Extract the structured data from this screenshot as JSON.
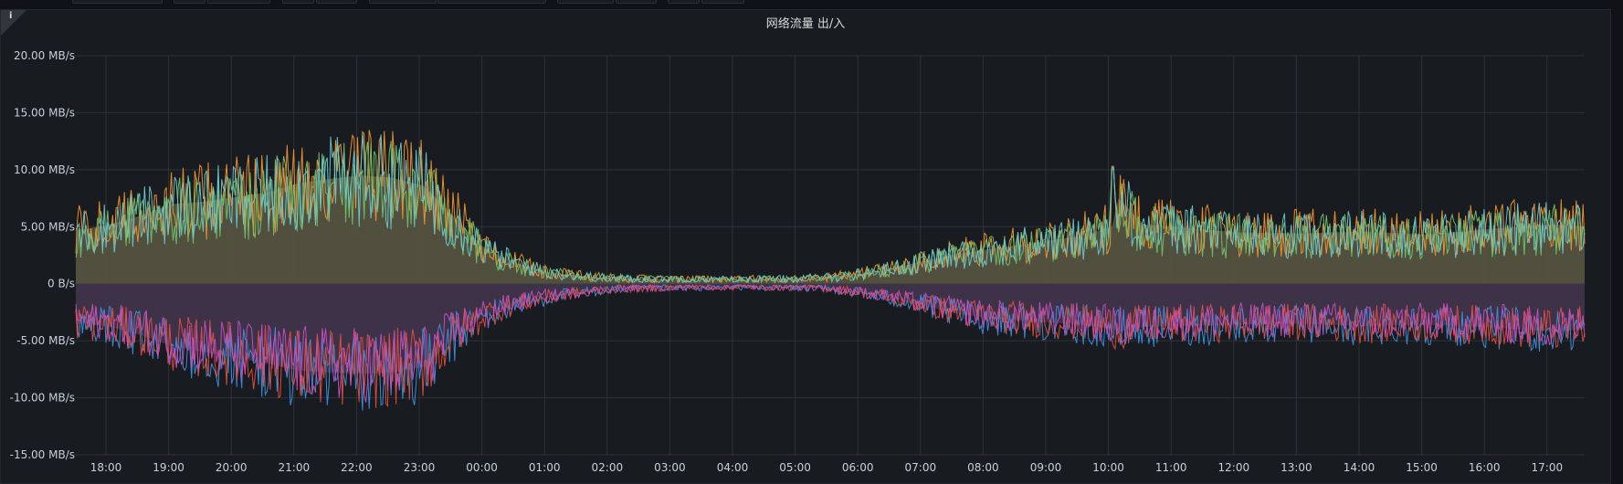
{
  "panel": {
    "title": "网络流量 出/入",
    "info_icon": "info-icon"
  },
  "colors": {
    "background": "#181b1f",
    "grid": "#2f3238",
    "positive_fill": "#54523f",
    "negative_fill": "#3f344b",
    "series_orange": "#f2952b",
    "series_green": "#73bf69",
    "series_teal": "#6ec7cf",
    "series_blue": "#3d8fe0",
    "series_red": "#e24d42",
    "series_purple": "#c351bd"
  },
  "chart_data": {
    "type": "area",
    "title": "网络流量 出/入",
    "xlabel": "",
    "ylabel": "",
    "ylim": [
      -15,
      20
    ],
    "y_unit": "MB/s",
    "y_ticks": [
      {
        "value": 20,
        "label": "20.00 MB/s"
      },
      {
        "value": 15,
        "label": "15.00 MB/s"
      },
      {
        "value": 10,
        "label": "10.00 MB/s"
      },
      {
        "value": 5,
        "label": "5.00 MB/s"
      },
      {
        "value": 0,
        "label": "0 B/s"
      },
      {
        "value": -5,
        "label": "-5.00 MB/s"
      },
      {
        "value": -10,
        "label": "-10.00 MB/s"
      },
      {
        "value": -15,
        "label": "-15.00 MB/s"
      }
    ],
    "x_ticks": [
      "18:00",
      "19:00",
      "20:00",
      "21:00",
      "22:00",
      "23:00",
      "00:00",
      "01:00",
      "02:00",
      "03:00",
      "04:00",
      "05:00",
      "06:00",
      "07:00",
      "08:00",
      "09:00",
      "10:00",
      "11:00",
      "12:00",
      "13:00",
      "14:00",
      "15:00",
      "16:00",
      "17:00"
    ],
    "x_range_hours": [
      17.6,
      17.6
    ],
    "grid": true,
    "legend": "none",
    "series_outline": {
      "hours_since_1800": [
        -0.4,
        0.0,
        0.5,
        1.0,
        1.5,
        2.0,
        2.5,
        3.0,
        3.5,
        4.0,
        4.5,
        5.0,
        5.3,
        5.6,
        6.0,
        6.5,
        7.0,
        7.5,
        8.0,
        9.0,
        10.0,
        11.0,
        11.5,
        12.0,
        12.5,
        13.0,
        13.5,
        14.0,
        15.0,
        15.5,
        16.0,
        16.1,
        16.5,
        17.0,
        18.0,
        19.0,
        20.0,
        21.0,
        22.0,
        23.0,
        23.6
      ],
      "outbound_positive": [
        4.8,
        5.2,
        6.0,
        7.0,
        7.2,
        7.6,
        8.0,
        8.8,
        9.2,
        9.5,
        9.3,
        8.6,
        7.0,
        5.2,
        3.0,
        1.8,
        1.0,
        0.7,
        0.5,
        0.4,
        0.4,
        0.45,
        0.6,
        0.9,
        1.4,
        2.0,
        2.6,
        3.0,
        3.8,
        4.2,
        5.0,
        7.5,
        5.2,
        5.0,
        4.5,
        4.4,
        4.6,
        4.3,
        4.8,
        5.2,
        5.0
      ],
      "inbound_negative": [
        -3.5,
        -3.8,
        -4.5,
        -5.5,
        -6.0,
        -6.5,
        -7.0,
        -7.6,
        -7.8,
        -7.9,
        -7.8,
        -7.3,
        -5.8,
        -4.2,
        -2.8,
        -1.8,
        -1.2,
        -0.8,
        -0.5,
        -0.35,
        -0.3,
        -0.35,
        -0.45,
        -0.8,
        -1.3,
        -1.9,
        -2.6,
        -3.0,
        -3.4,
        -3.6,
        -3.9,
        -4.2,
        -3.8,
        -3.7,
        -3.6,
        -3.5,
        -3.7,
        -3.6,
        -3.8,
        -4.2,
        -4.0
      ]
    },
    "series": [
      {
        "color_key": "series_orange",
        "sign": 1,
        "level": 1.0
      },
      {
        "color_key": "series_green",
        "sign": 1,
        "level": 0.92
      },
      {
        "color_key": "series_teal",
        "sign": 1,
        "level": 0.96
      },
      {
        "color_key": "series_blue",
        "sign": -1,
        "level": 1.0
      },
      {
        "color_key": "series_red",
        "sign": -1,
        "level": 0.95
      },
      {
        "color_key": "series_purple",
        "sign": -1,
        "level": 0.9
      }
    ],
    "peaks": {
      "outbound_max": 16.0,
      "outbound_max_time": "21:30",
      "inbound_min": -11.8,
      "inbound_min_time": "21:30",
      "spike_value": 10.3,
      "spike_time": "10:00"
    }
  }
}
